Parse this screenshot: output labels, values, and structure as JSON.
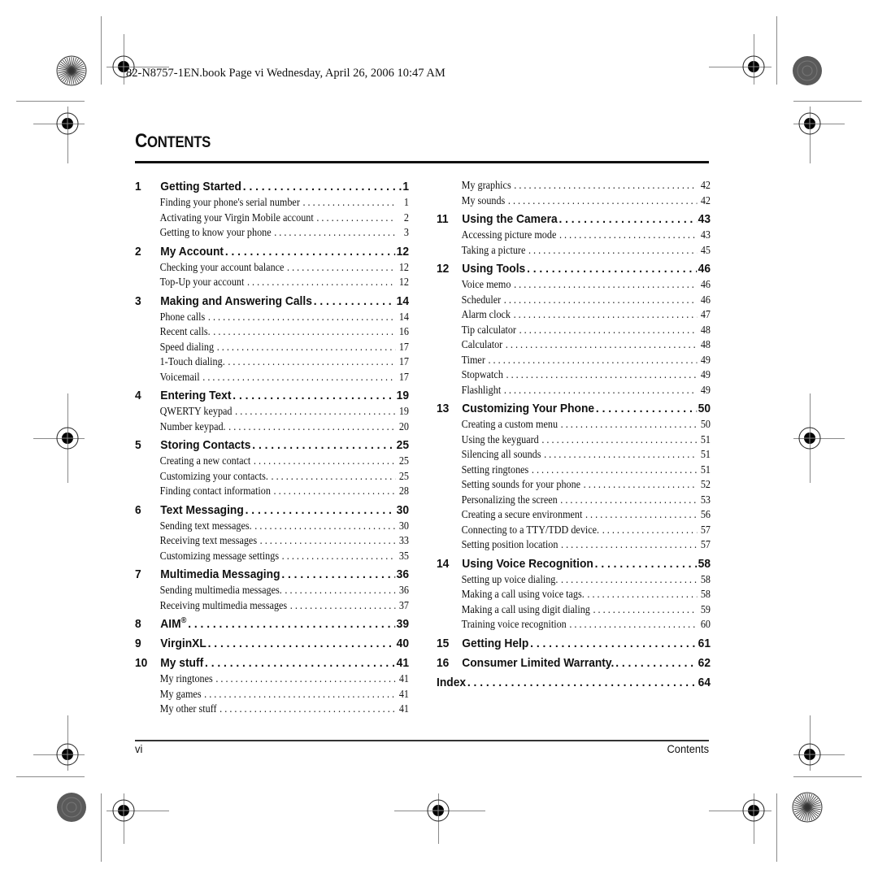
{
  "print_header": "82-N8757-1EN.book  Page vi  Wednesday, April 26, 2006  10:47 AM",
  "title_first": "C",
  "title_rest": "ONTENTS",
  "left_column": [
    {
      "num": "1",
      "title": "Getting Started",
      "page": "1",
      "subs": [
        {
          "title": "Finding your phone's serial number",
          "page": "1"
        },
        {
          "title": "Activating your Virgin Mobile account",
          "page": "2"
        },
        {
          "title": "Getting to know your phone",
          "page": "3"
        }
      ]
    },
    {
      "num": "2",
      "title": "My Account",
      "page": "12",
      "subs": [
        {
          "title": "Checking your account balance",
          "page": "12"
        },
        {
          "title": "Top-Up your account",
          "page": "12"
        }
      ]
    },
    {
      "num": "3",
      "title": "Making and Answering Calls",
      "page": "14",
      "subs": [
        {
          "title": "Phone calls",
          "page": "14"
        },
        {
          "title": "Recent calls.",
          "page": "16"
        },
        {
          "title": "Speed dialing",
          "page": "17"
        },
        {
          "title": "1-Touch dialing.",
          "page": "17"
        },
        {
          "title": "Voicemail",
          "page": "17"
        }
      ]
    },
    {
      "num": "4",
      "title": "Entering Text",
      "page": "19",
      "subs": [
        {
          "title": "QWERTY keypad",
          "page": "19"
        },
        {
          "title": "Number keypad.",
          "page": "20"
        }
      ]
    },
    {
      "num": "5",
      "title": "Storing Contacts",
      "page": "25",
      "subs": [
        {
          "title": "Creating a new contact",
          "page": "25"
        },
        {
          "title": "Customizing your contacts.",
          "page": "25"
        },
        {
          "title": "Finding contact information",
          "page": "28"
        }
      ]
    },
    {
      "num": "6",
      "title": "Text Messaging",
      "page": "30",
      "subs": [
        {
          "title": "Sending text messages.",
          "page": "30"
        },
        {
          "title": "Receiving text messages",
          "page": "33"
        },
        {
          "title": "Customizing message settings",
          "page": "35"
        }
      ]
    },
    {
      "num": "7",
      "title": "Multimedia Messaging",
      "page": "36",
      "subs": [
        {
          "title": "Sending multimedia messages.",
          "page": "36"
        },
        {
          "title": "Receiving multimedia messages",
          "page": "37"
        }
      ]
    },
    {
      "num": "8",
      "title": "AIM",
      "sup": "®",
      "page": "39",
      "subs": []
    },
    {
      "num": "9",
      "title": "VirginXL",
      "page": "40",
      "subs": []
    },
    {
      "num": "10",
      "title": "My stuff",
      "page": "41",
      "subs": [
        {
          "title": "My ringtones",
          "page": "41"
        },
        {
          "title": "My games",
          "page": "41"
        },
        {
          "title": "My other stuff",
          "page": "41"
        }
      ]
    }
  ],
  "right_column_leading_subs": [
    {
      "title": "My graphics",
      "page": "42"
    },
    {
      "title": "My sounds",
      "page": "42"
    }
  ],
  "right_column": [
    {
      "num": "11",
      "title": "Using the Camera",
      "page": "43",
      "subs": [
        {
          "title": "Accessing picture mode",
          "page": "43"
        },
        {
          "title": "Taking a picture",
          "page": "45"
        }
      ]
    },
    {
      "num": "12",
      "title": "Using Tools",
      "page": "46",
      "subs": [
        {
          "title": "Voice memo",
          "page": "46"
        },
        {
          "title": "Scheduler",
          "page": "46"
        },
        {
          "title": "Alarm clock",
          "page": "47"
        },
        {
          "title": "Tip calculator",
          "page": "48"
        },
        {
          "title": "Calculator",
          "page": "48"
        },
        {
          "title": "Timer",
          "page": "49"
        },
        {
          "title": "Stopwatch",
          "page": "49"
        },
        {
          "title": "Flashlight",
          "page": "49"
        }
      ]
    },
    {
      "num": "13",
      "title": "Customizing Your Phone",
      "page": "50",
      "subs": [
        {
          "title": "Creating a custom menu",
          "page": "50"
        },
        {
          "title": "Using the keyguard",
          "page": "51"
        },
        {
          "title": "Silencing all sounds",
          "page": "51"
        },
        {
          "title": "Setting ringtones",
          "page": "51"
        },
        {
          "title": "Setting sounds for your phone",
          "page": "52"
        },
        {
          "title": "Personalizing the screen",
          "page": "53"
        },
        {
          "title": "Creating a secure environment",
          "page": "56"
        },
        {
          "title": "Connecting to a TTY/TDD device.",
          "page": "57"
        },
        {
          "title": "Setting position location",
          "page": "57"
        }
      ]
    },
    {
      "num": "14",
      "title": "Using Voice Recognition",
      "page": "58",
      "subs": [
        {
          "title": "Setting up voice dialing.",
          "page": "58"
        },
        {
          "title": "Making a call using voice tags.",
          "page": "58"
        },
        {
          "title": "Making a call using digit dialing",
          "page": "59"
        },
        {
          "title": "Training voice recognition",
          "page": "60"
        }
      ]
    },
    {
      "num": "15",
      "title": "Getting Help",
      "page": "61",
      "subs": []
    },
    {
      "num": "16",
      "title": "Consumer Limited Warranty.",
      "page": "62",
      "subs": []
    },
    {
      "num": "",
      "title": "Index",
      "page": "64",
      "subs": []
    }
  ],
  "footer": {
    "page_number": "vi",
    "section": "Contents"
  }
}
